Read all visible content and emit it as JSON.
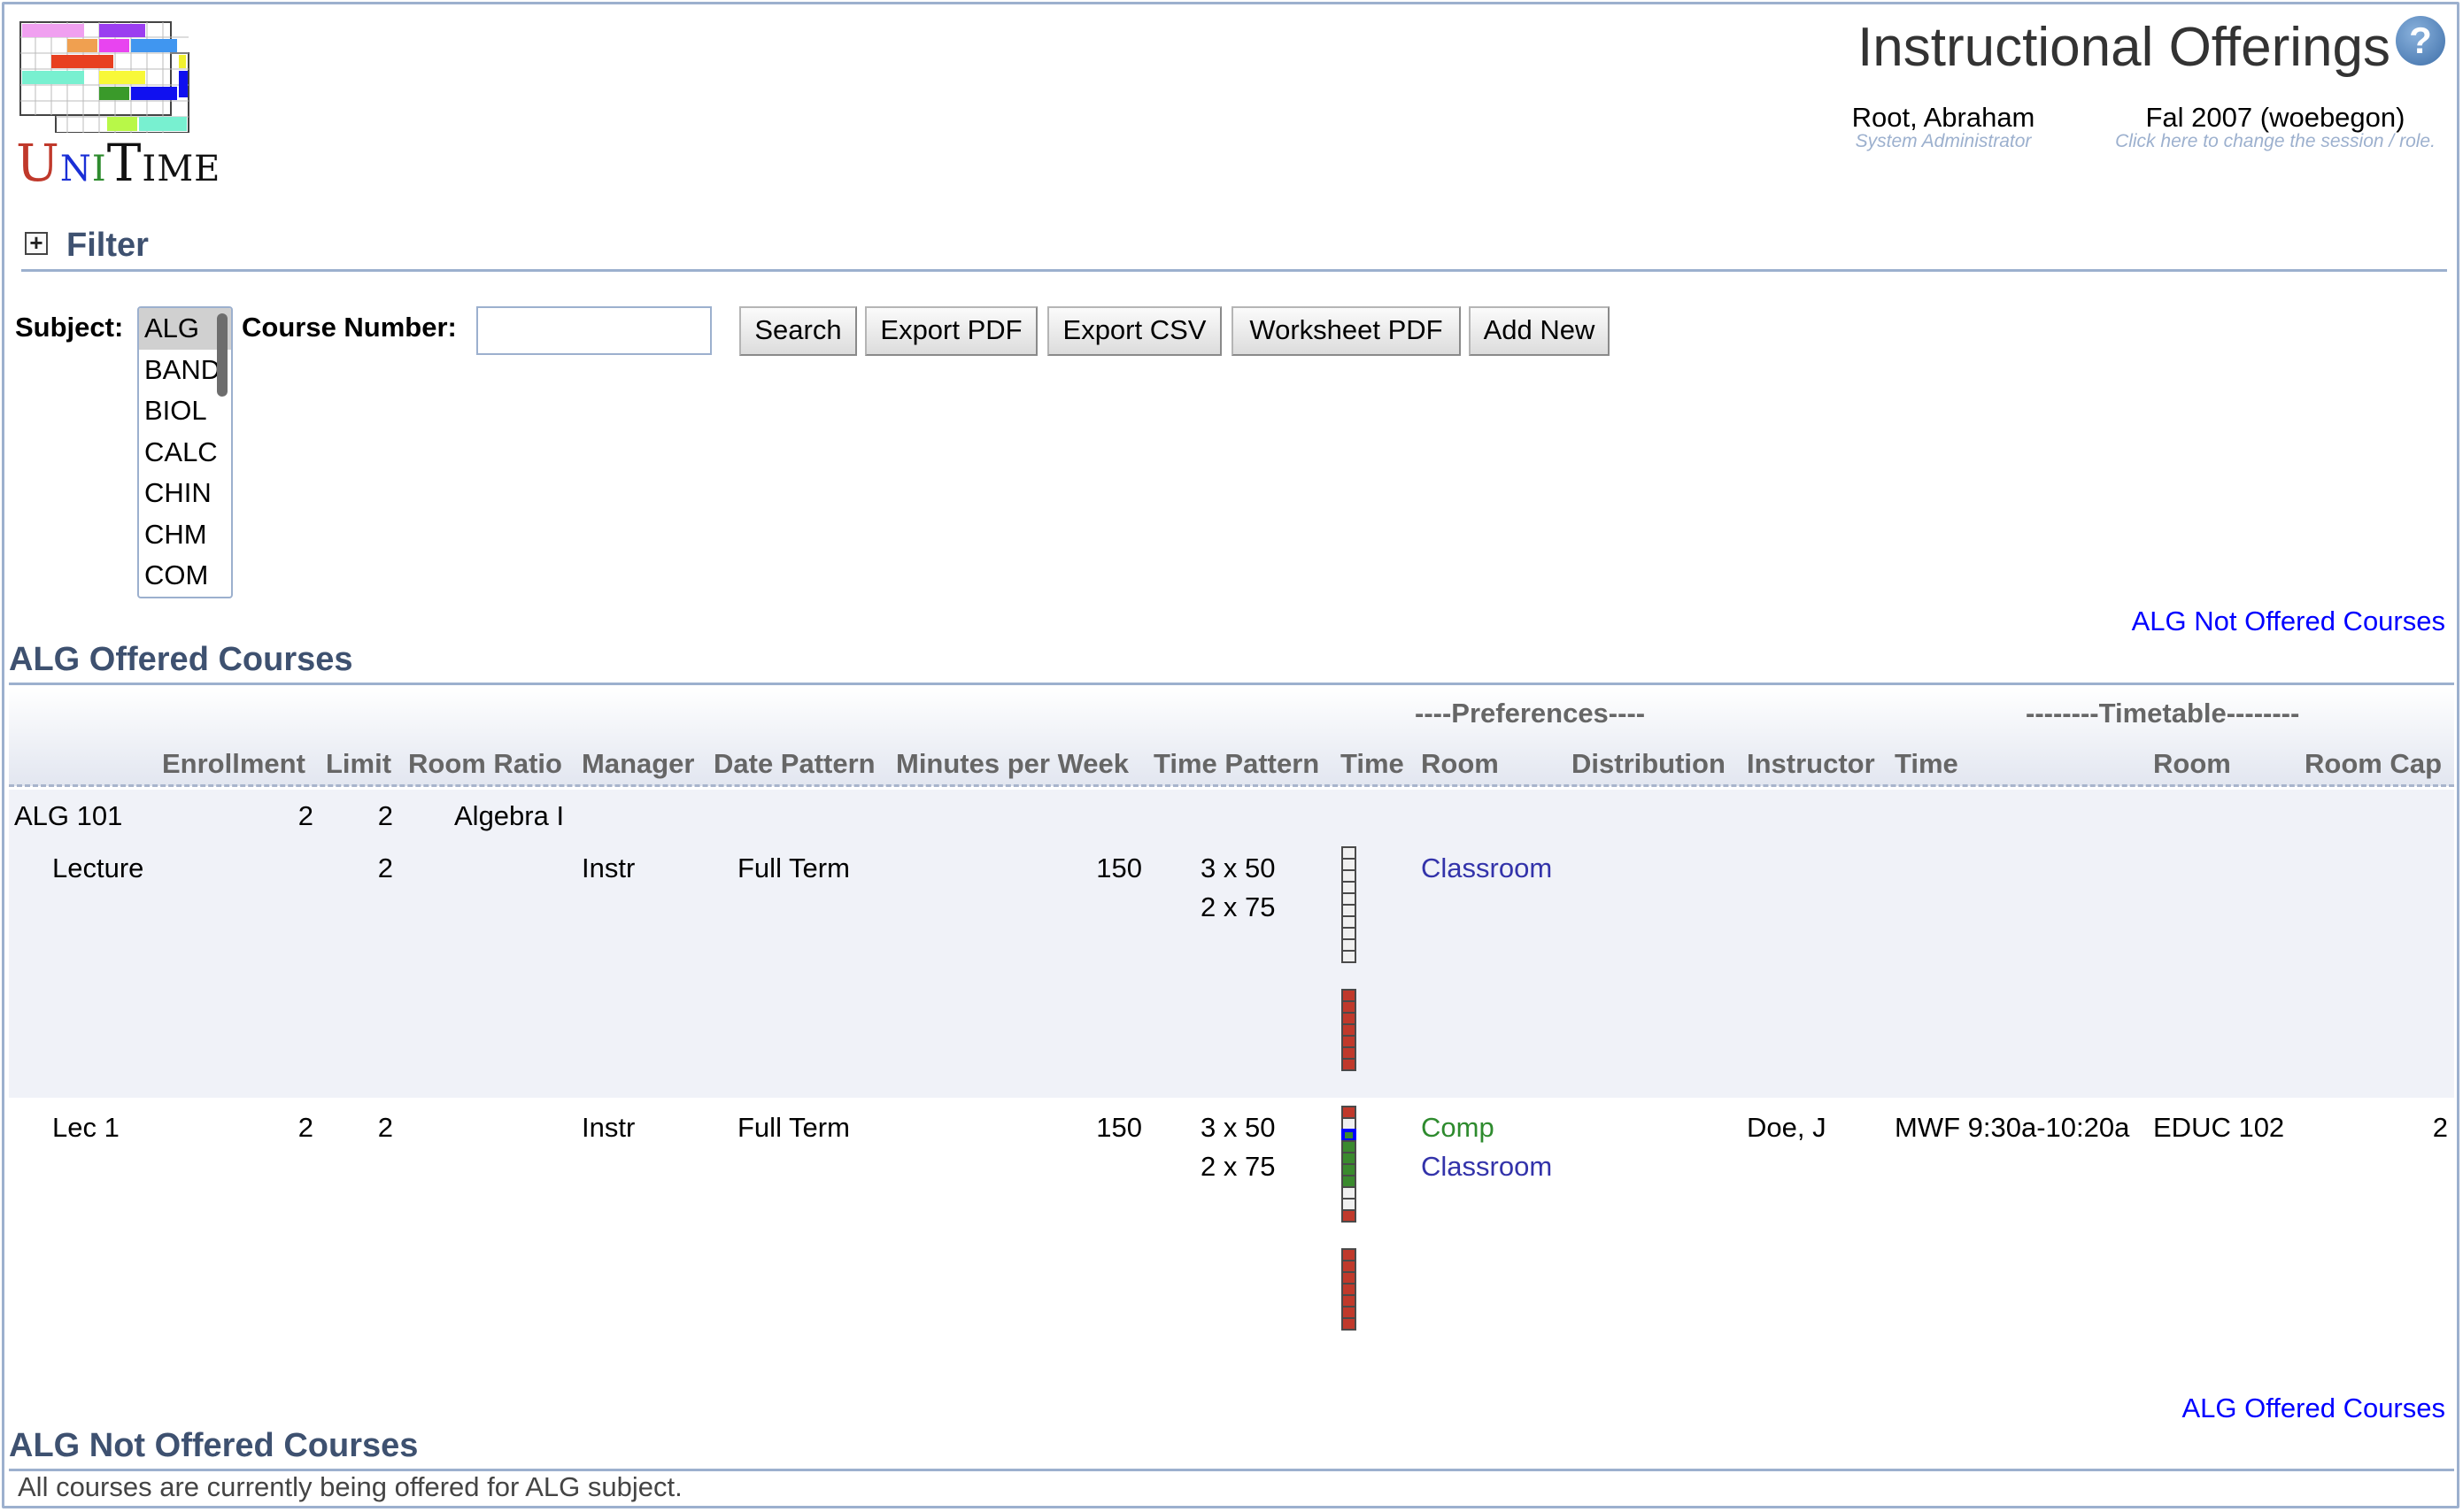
{
  "app": {
    "logo_alt": "UniTime"
  },
  "header": {
    "title": "Instructional Offerings",
    "help_glyph": "?",
    "user": {
      "name": "Root, Abraham",
      "role": "System Administrator"
    },
    "session": {
      "name": "Fal 2007 (woebegon)",
      "hint": "Click here to change the session / role."
    }
  },
  "filter": {
    "title": "Filter",
    "expand_glyph": "+",
    "subject_label": "Subject:",
    "subjects": [
      "ALG",
      "BAND",
      "BIOL",
      "CALC",
      "CHIN",
      "CHM",
      "COM"
    ],
    "selected_subject": "ALG",
    "course_number_label": "Course Number:",
    "course_number_value": "",
    "buttons": {
      "search": "Search",
      "export_pdf": "Export PDF",
      "export_csv": "Export CSV",
      "worksheet_pdf": "Worksheet PDF",
      "add_new": "Add New"
    }
  },
  "offered": {
    "jump_link": "ALG Not Offered Courses",
    "title": "ALG Offered Courses",
    "group_headers": {
      "preferences": "----Preferences----",
      "timetable": "--------Timetable--------"
    },
    "columns": {
      "enrollment": "Enrollment",
      "limit": "Limit",
      "room_ratio": "Room Ratio",
      "manager": "Manager",
      "date_pattern": "Date Pattern",
      "minutes_per_week": "Minutes per Week",
      "time_pattern": "Time Pattern",
      "pref_time": "Time",
      "pref_room": "Room",
      "distribution": "Distribution",
      "instructor": "Instructor",
      "tt_time": "Time",
      "tt_room": "Room",
      "room_cap": "Room Cap"
    },
    "course": {
      "name": "ALG 101",
      "enrollment": "2",
      "limit": "2",
      "title": "Algebra I"
    },
    "rows": [
      {
        "name": "Lecture",
        "enrollment": "",
        "limit": "2",
        "manager": "Instr",
        "date_pattern": "Full Term",
        "minutes_per_week": "150",
        "time_patterns": [
          "3 x 50",
          "2 x 75"
        ],
        "time_grid_top": [
          "white",
          "white",
          "white",
          "white",
          "white",
          "white",
          "white",
          "white",
          "white",
          "white"
        ],
        "time_grid_bottom": [
          "red",
          "red",
          "red",
          "red",
          "red",
          "red",
          "red"
        ],
        "room_prefs": [
          {
            "label": "Classroom",
            "level": "preferred"
          }
        ],
        "instructor": "",
        "tt_time": "",
        "tt_room": "",
        "room_cap": ""
      },
      {
        "name": "Lec 1",
        "enrollment": "2",
        "limit": "2",
        "manager": "Instr",
        "date_pattern": "Full Term",
        "minutes_per_week": "150",
        "time_patterns": [
          "3 x 50",
          "2 x 75"
        ],
        "time_grid_top": [
          "red",
          "white",
          "assigned",
          "green",
          "green",
          "green",
          "green",
          "white",
          "white",
          "red"
        ],
        "time_grid_bottom": [
          "red",
          "red",
          "red",
          "red",
          "red",
          "red",
          "red"
        ],
        "room_prefs": [
          {
            "label": "Comp",
            "level": "required"
          },
          {
            "label": "Classroom",
            "level": "preferred"
          }
        ],
        "instructor": "Doe, J",
        "tt_time": "MWF 9:30a-10:20a",
        "tt_room": "EDUC 102",
        "room_cap": "2"
      }
    ]
  },
  "not_offered": {
    "jump_link": "ALG Offered Courses",
    "title": "ALG Not Offered Courses",
    "message": "All courses are currently being offered for ALG subject."
  },
  "colors": {
    "section_title": "#3e5170",
    "link": "#0000ff",
    "pref_preferred": "#3333aa",
    "pref_required": "#2e8b2e",
    "grid_prohibited": "#c0392b",
    "grid_required": "#3a8a2e",
    "border": "#9cb0ce"
  }
}
